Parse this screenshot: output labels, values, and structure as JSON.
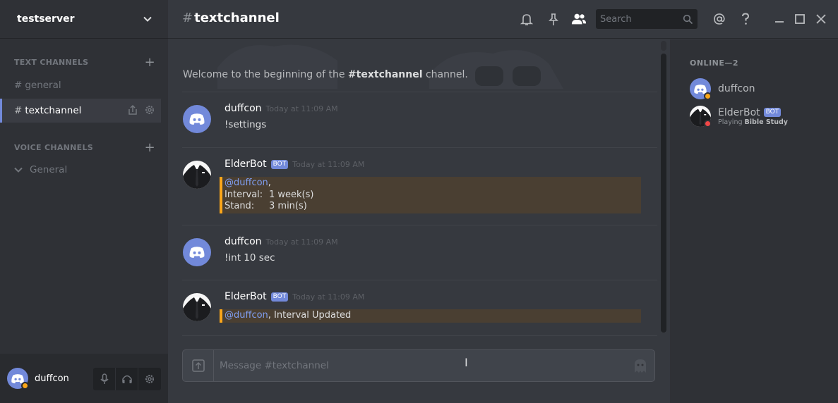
{
  "server": {
    "name": "testserver"
  },
  "sidebar": {
    "text_category": "TEXT CHANNELS",
    "voice_category": "VOICE CHANNELS",
    "text_channels": [
      {
        "name": "general"
      },
      {
        "name": "textchannel"
      }
    ],
    "voice_channels": [
      {
        "name": "General"
      }
    ]
  },
  "user_panel": {
    "username": "duffcon"
  },
  "topbar": {
    "channel_name": "textchannel",
    "search_placeholder": "Search"
  },
  "chat": {
    "welcome_prefix": "Welcome to the beginning of the ",
    "welcome_channel": "#textchannel",
    "welcome_suffix": " channel.",
    "bot_tag": "BOT",
    "messages": [
      {
        "author": "duffcon",
        "timestamp": "Today at 11:09 AM",
        "text": "!settings"
      },
      {
        "author": "ElderBot",
        "timestamp": "Today at 11:09 AM",
        "embed": {
          "mention": "@duffcon",
          "after_mention": ",",
          "rows": [
            {
              "label": "Interval:",
              "value": "1 week(s)"
            },
            {
              "label": "Stand:",
              "value": "3 min(s)"
            }
          ]
        }
      },
      {
        "author": "duffcon",
        "timestamp": "Today at 11:09 AM",
        "text": "!int 10 sec"
      },
      {
        "author": "ElderBot",
        "timestamp": "Today at 11:09 AM",
        "embed": {
          "mention": "@duffcon",
          "after_mention": ", Interval Updated"
        }
      }
    ],
    "input_placeholder": "Message #textchannel"
  },
  "members": {
    "header": "ONLINE—2",
    "list": [
      {
        "name": "duffcon",
        "status_color": "#faa61a"
      },
      {
        "name": "ElderBot",
        "bot_tag": "BOT",
        "playing_prefix": "Playing ",
        "playing_game": "Bible Study",
        "status_color": "#f04747"
      }
    ]
  },
  "colors": {
    "accent": "#7289da",
    "embed_border": "#faa61a",
    "idle": "#faa61a",
    "dnd": "#f04747"
  }
}
